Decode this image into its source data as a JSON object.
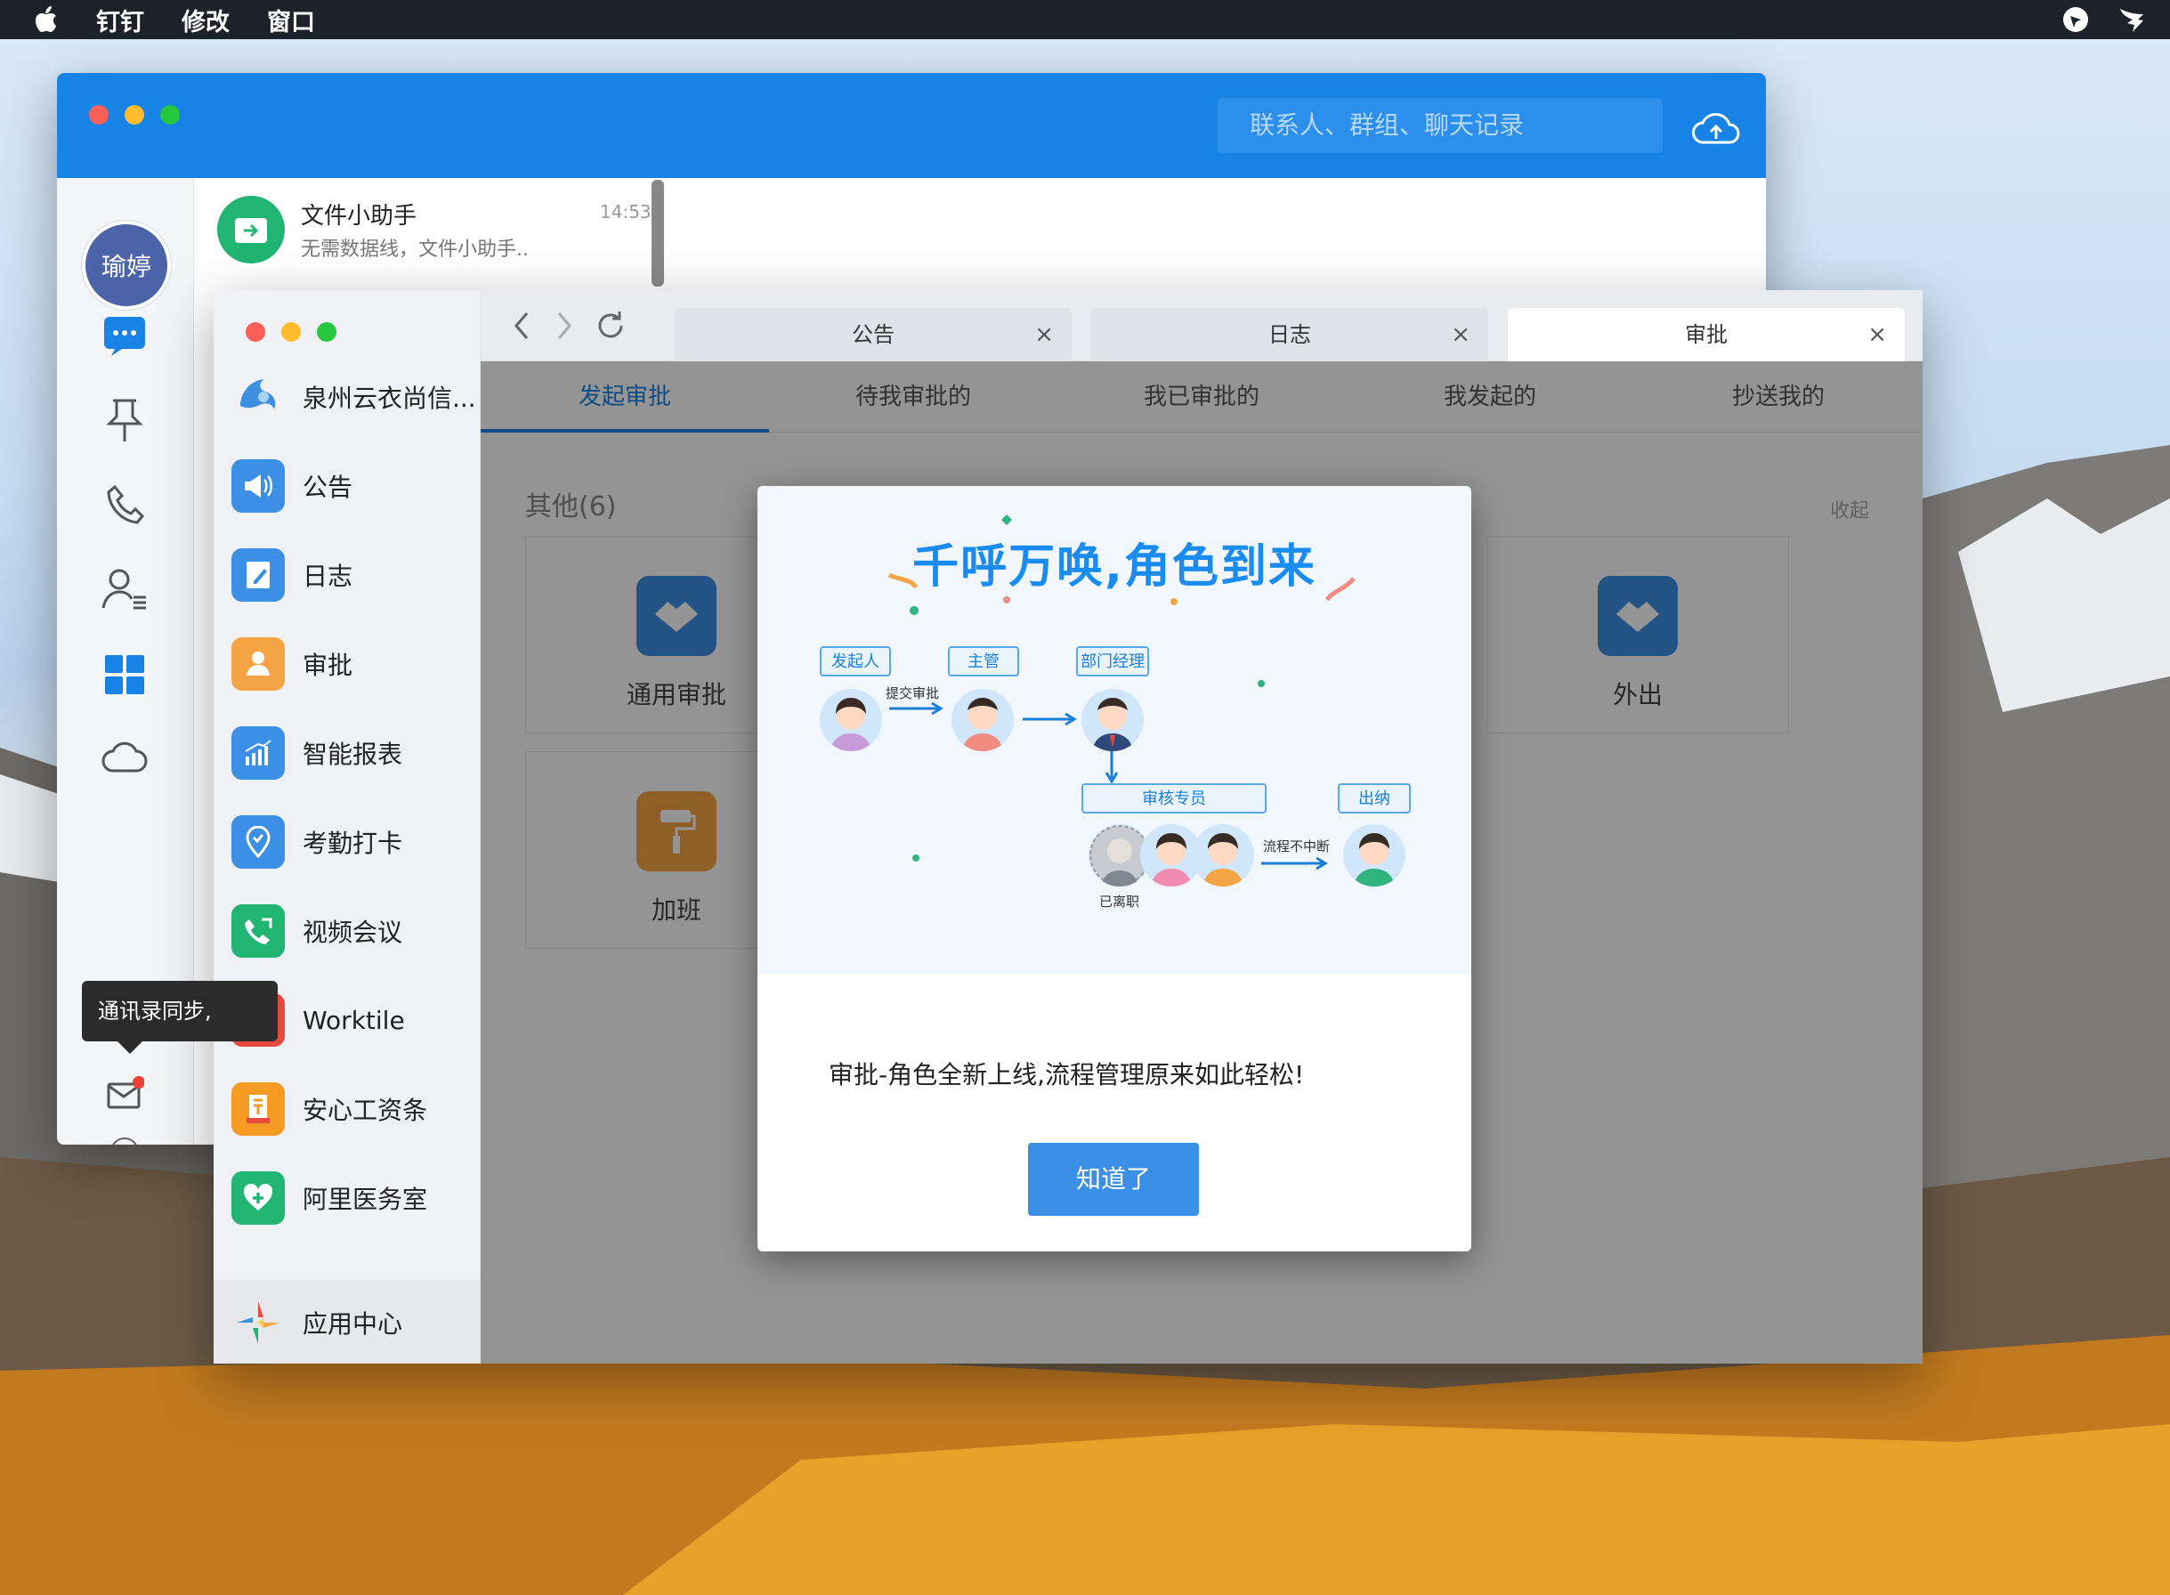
{
  "menubar": {
    "apple_icon": "apple-icon",
    "items": [
      "钉钉",
      "修改",
      "窗口"
    ],
    "status_icons": [
      "focus-icon",
      "dingtalk-bird-icon"
    ]
  },
  "main_window": {
    "search_placeholder": "联系人、群组、聊天记录",
    "user_avatar": "瑜婷",
    "chat": {
      "name": "文件小助手",
      "time": "14:53",
      "preview": "无需数据线，文件小助手.."
    },
    "rail_icons": [
      "message-icon",
      "pin-icon",
      "phone-icon",
      "contacts-icon",
      "workbench-icon",
      "cloud-icon",
      "mail-icon",
      "add-circle-icon",
      "more-circle-icon"
    ],
    "tooltip": "通讯录同步,"
  },
  "workbench": {
    "apps": [
      {
        "label": "泉州云衣尚信...",
        "icon": "org-logo-icon",
        "color": "#ffffff"
      },
      {
        "label": "公告",
        "icon": "megaphone-icon",
        "color": "#3b8fe4"
      },
      {
        "label": "日志",
        "icon": "notebook-icon",
        "color": "#3b8fe4"
      },
      {
        "label": "审批",
        "icon": "approval-person-icon",
        "color": "#f5a443"
      },
      {
        "label": "智能报表",
        "icon": "report-chart-icon",
        "color": "#3b8fe4"
      },
      {
        "label": "考勤打卡",
        "icon": "location-pin-icon",
        "color": "#3b8fe4"
      },
      {
        "label": "视频会议",
        "icon": "video-phone-icon",
        "color": "#21b573"
      },
      {
        "label": "Worktile",
        "icon": "worktile-icon",
        "color": "#e5493f"
      },
      {
        "label": "安心工资条",
        "icon": "salary-icon",
        "color": "#f59a23"
      },
      {
        "label": "阿里医务室",
        "icon": "heart-plus-icon",
        "color": "#21b573"
      }
    ],
    "app_center": "应用中心",
    "tabs": [
      {
        "label": "公告",
        "active": false
      },
      {
        "label": "日志",
        "active": false
      },
      {
        "label": "审批",
        "active": true
      }
    ],
    "subtabs": [
      "发起审批",
      "待我审批的",
      "我已审批的",
      "我发起的",
      "抄送我的"
    ],
    "section_title": "其他(6)",
    "collapse": "收起",
    "cards": [
      "通用审批",
      "加班",
      "外出"
    ]
  },
  "modal": {
    "title": "千呼万唤,角色到来",
    "roles": {
      "initiator": "发起人",
      "supervisor": "主管",
      "dept_manager": "部门经理",
      "auditor": "审核专员",
      "cashier": "出纳"
    },
    "flow_submit": "提交审批",
    "flow_continue": "流程不中断",
    "resigned": "已离职",
    "message": "审批-角色全新上线,流程管理原来如此轻松!",
    "button": "知道了"
  },
  "colors": {
    "brand_blue": "#1883e7",
    "button_blue": "#3b8fe4",
    "green": "#21b573",
    "orange": "#f5a443"
  }
}
